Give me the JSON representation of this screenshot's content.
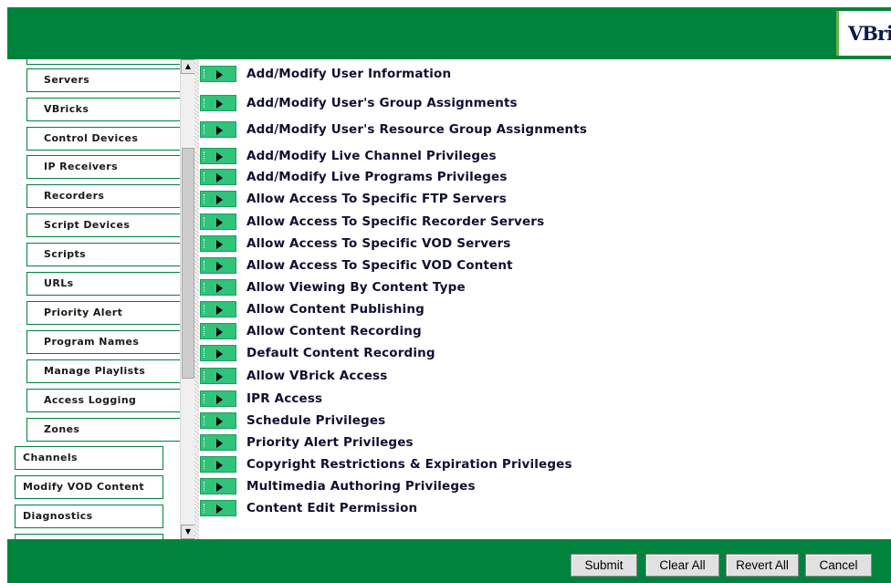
{
  "header": {
    "logo_text": "VBrick"
  },
  "sidebar": {
    "sub_items": [
      {
        "label": "Servers"
      },
      {
        "label": "VBricks"
      },
      {
        "label": "Control Devices"
      },
      {
        "label": "IP Receivers"
      },
      {
        "label": "Recorders"
      },
      {
        "label": "Script Devices"
      },
      {
        "label": "Scripts"
      },
      {
        "label": "URLs"
      },
      {
        "label": "Priority Alert"
      },
      {
        "label": "Program Names"
      },
      {
        "label": "Manage Playlists"
      },
      {
        "label": "Access Logging"
      },
      {
        "label": "Zones"
      }
    ],
    "top_items": [
      {
        "label": "Channels"
      },
      {
        "label": "Modify VOD Content"
      },
      {
        "label": "Diagnostics"
      }
    ]
  },
  "privileges": [
    {
      "label": "Add/Modify User Information"
    },
    {
      "label": "Add/Modify User's Group Assignments"
    },
    {
      "label": "Add/Modify User's Resource Group Assignments"
    },
    {
      "label": "Add/Modify Live Channel Privileges"
    },
    {
      "label": "Add/Modify Live Programs Privileges"
    },
    {
      "label": "Allow Access To Specific FTP Servers"
    },
    {
      "label": "Allow Access To Specific Recorder Servers"
    },
    {
      "label": "Allow Access To Specific VOD Servers"
    },
    {
      "label": "Allow Access To Specific VOD Content"
    },
    {
      "label": "Allow Viewing By Content Type"
    },
    {
      "label": "Allow Content Publishing"
    },
    {
      "label": "Allow Content Recording"
    },
    {
      "label": "Default Content Recording"
    },
    {
      "label": "Allow VBrick Access"
    },
    {
      "label": "IPR Access"
    },
    {
      "label": "Schedule Privileges"
    },
    {
      "label": "Priority Alert Privileges"
    },
    {
      "label": "Copyright Restrictions & Expiration Privileges"
    },
    {
      "label": "Multimedia Authoring Privileges"
    },
    {
      "label": "Content Edit Permission"
    }
  ],
  "footer": {
    "submit_label": "Submit",
    "clear_all_label": "Clear All",
    "revert_all_label": "Revert All",
    "cancel_label": "Cancel"
  },
  "icons": {
    "expand": "triangle-right-icon",
    "scroll_up": "arrow-up-icon",
    "scroll_down": "arrow-down-icon"
  },
  "colors": {
    "brand_green": "#00843d",
    "button_green": "#30c37a",
    "nav_border": "#008040"
  }
}
